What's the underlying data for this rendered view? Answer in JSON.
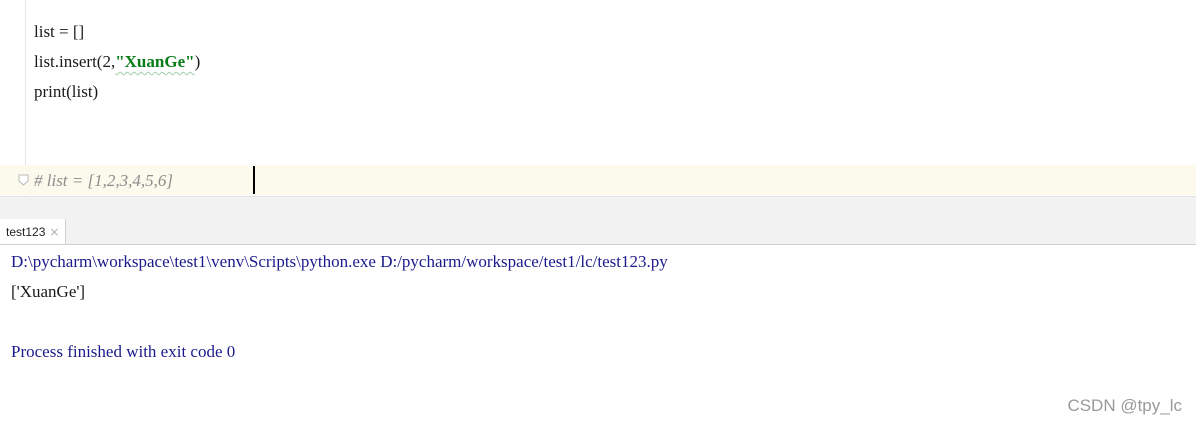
{
  "editor": {
    "lines": [
      "list = []",
      "list.insert(2,",
      "print(list)"
    ],
    "insert_string": "\"XuanGe\"",
    "insert_close": ")",
    "comment": "# list = [1,2,3,4,5,6]"
  },
  "tool_window": {
    "tab_label": "test123",
    "tab_close": "×"
  },
  "console": {
    "command": "D:\\pycharm\\workspace\\test1\\venv\\Scripts\\python.exe D:/pycharm/workspace/test1/lc/test123.py",
    "output": "['XuanGe']",
    "exit_message": "Process finished with exit code 0"
  },
  "watermark": "CSDN @tpy_lc",
  "colors": {
    "string": "#067d17",
    "comment": "#8c8c8c",
    "console_system": "#1a1a8c",
    "caret_row": "#fcfaed"
  }
}
